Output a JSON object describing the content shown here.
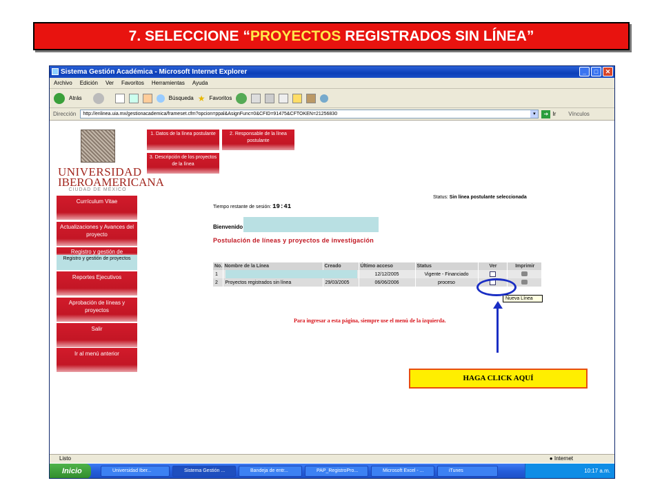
{
  "slide": {
    "title_prefix": "7. SELECCIONE “",
    "title_highlight": "PROYECTOS",
    "title_suffix": " REGISTRADOS SIN LÍNEA”",
    "callout": "HAGA CLICK AQUÍ",
    "colors": {
      "title_bg": "#e8130f",
      "highlight": "#ffe94b",
      "callout_bg": "#ffef00",
      "arrow": "#1a2ec4"
    }
  },
  "browser": {
    "window_title": "Sistema Gestión Académica - Microsoft Internet Explorer",
    "menu": [
      "Archivo",
      "Edición",
      "Ver",
      "Favoritos",
      "Herramientas",
      "Ayuda"
    ],
    "toolbar": {
      "back": "Atrás",
      "search": "Búsqueda",
      "favorites": "Favoritos"
    },
    "address_label": "Dirección",
    "url": "http://enlinea.uia.mx/gestionacademica/frameset.cfm?opcion=ppal&AsignFunc=0&CFID=91475&CFTOKEN=21256830",
    "go_label": "Ir",
    "links_label": "Vínculos",
    "status_text": "Listo",
    "zone_text": "Internet"
  },
  "logo": {
    "line1": "UNIVERSIDAD",
    "line2": "IBEROAMERICANA",
    "line3": "CIUDAD DE MÉXICO"
  },
  "sidebar": [
    {
      "label": "Currículum Vitae"
    },
    {
      "label": "Actualizaciones y Avances del proyecto"
    },
    {
      "label": "Registro y gestión de"
    },
    {
      "label": "Reportes Ejecutivos"
    },
    {
      "label": "Aprobación de líneas y proyectos"
    },
    {
      "label": "Salir"
    },
    {
      "label": "Ir al menú anterior"
    }
  ],
  "sidebar_sub": "Registro y gestión de proyectos",
  "tabs": [
    {
      "label": "1. Datos de la línea postulante"
    },
    {
      "label": "2. Responsable de la línea postulante"
    },
    {
      "label": "3. Descripción de los proyectos de la línea"
    }
  ],
  "status_label": "Status:",
  "status_value": "Sin línea postulante seleccionada",
  "session_label": "Tiempo restante de sesión:",
  "session_time": "19:41",
  "welcome": "Bienvenido",
  "section_title": "Postulación de líneas y proyectos de investigación",
  "table": {
    "headers": [
      "No.",
      "Nombre de la Línea",
      "Creado",
      "Último acceso",
      "Status",
      "Ver",
      "Imprimir"
    ],
    "rows": [
      {
        "no": "1",
        "name": "",
        "created": "",
        "last": "12/12/2005",
        "status": "Vigente - Financiado"
      },
      {
        "no": "2",
        "name": "Proyectos registrados sin línea",
        "created": "29/03/2005",
        "last": "06/06/2006",
        "status": "proceso"
      }
    ]
  },
  "tooltip": "Nueva Línea",
  "note": "Para ingresar a esta página, siempre use el menú de la izquierda.",
  "taskbar": {
    "start": "Inicio",
    "tasks": [
      "Universidad Iber...",
      "Sistema Gestión ...",
      "Bandeja de entr...",
      "PAP_RegistroPro...",
      "Microsoft Excel - ...",
      "iTunes"
    ],
    "clock": "10:17 a.m."
  }
}
